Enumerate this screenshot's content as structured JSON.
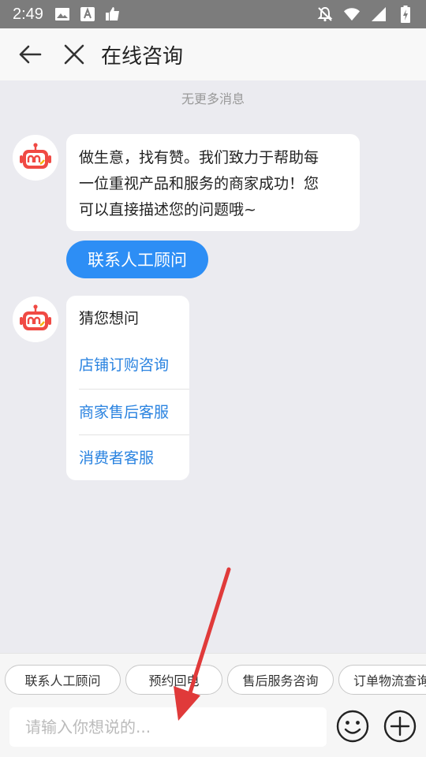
{
  "status_bar": {
    "time": "2:49",
    "icons": [
      "image-icon",
      "a-badge-icon",
      "thumbs-up-icon"
    ],
    "right_icons": [
      "notifications-off-icon",
      "wifi-icon",
      "signal-icon",
      "battery-charging-icon"
    ]
  },
  "nav": {
    "title": "在线咨询",
    "back_icon": "back-arrow-icon",
    "close_icon": "close-icon"
  },
  "chat": {
    "no_more": "无更多消息",
    "welcome_lines": [
      "做生意，找有赞。我们致力于帮助每",
      "一位重视产品和服务的商家成功！您",
      "可以直接描述您的问题哦~"
    ],
    "contact_button": "联系人工顾问",
    "guess": {
      "title": "猜您想问",
      "items": [
        "店铺订购咨询",
        "商家售后客服",
        "消费者客服"
      ]
    }
  },
  "quick_replies": [
    "联系人工顾问",
    "预约回电",
    "售后服务咨询",
    "订单物流查询"
  ],
  "input": {
    "placeholder": "请输入你想说的..."
  },
  "icons": {
    "emoji": "emoji-icon",
    "plus": "plus-icon"
  },
  "colors": {
    "accent": "#2d8ef5",
    "link": "#2a83e0",
    "robot": "#f04a44",
    "annotation": "#e03a3a"
  }
}
